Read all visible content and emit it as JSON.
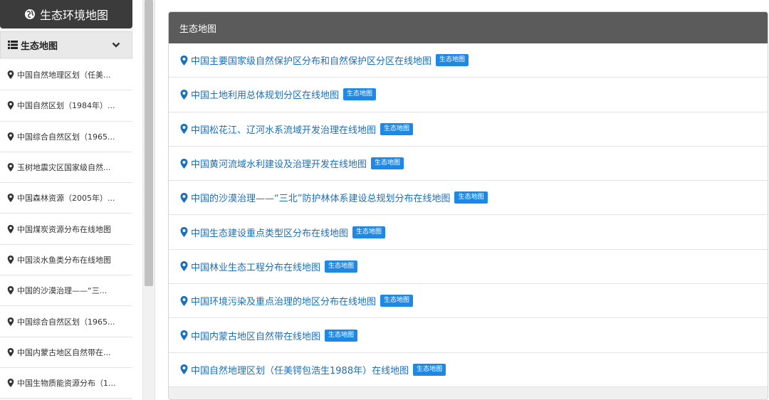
{
  "sidebar": {
    "brand": "生态环境地图",
    "menu_title": "生态地图",
    "items": [
      "中国自然地理区划（任美...",
      "中国自然区划（1984年）...",
      "中国综合自然区划（1965...",
      "玉树地震灾区国家级自然...",
      "中国森林资源（2005年）...",
      "中国煤炭资源分布在线地图",
      "中国淡水鱼类分布在线地图",
      "中国的沙漠治理——“三...",
      "中国综合自然区划（1965...",
      "中国内蒙古地区自然带在...",
      "中国生物质能资源分布（1..."
    ]
  },
  "panel": {
    "title": "生态地图",
    "badge": "生态地图",
    "rows": [
      "中国主要国家级自然保护区分布和自然保护区分区在线地图",
      "中国土地利用总体规划分区在线地图",
      "中国松花江、辽河水系流域开发治理在线地图",
      "中国黄河流域水利建设及治理开发在线地图",
      "中国的沙漠治理——“三北”防护林体系建设总规划分布在线地图",
      "中国生态建设重点类型区分布在线地图",
      "中国林业生态工程分布在线地图",
      "中国环境污染及重点治理的地区分布在线地图",
      "中国内蒙古地区自然带在线地图",
      "中国自然地理区划（任美锷包浩生1988年）在线地图"
    ]
  },
  "colors": {
    "brand_bg": "#3b3b3b",
    "panel_header": "#5b5b5b",
    "link": "#1c6fb8",
    "badge": "#1e88e5"
  },
  "icons": {
    "brand": "globe-icon",
    "menu": "list-icon",
    "collapse": "chevron-down-icon",
    "item": "map-marker-icon"
  }
}
